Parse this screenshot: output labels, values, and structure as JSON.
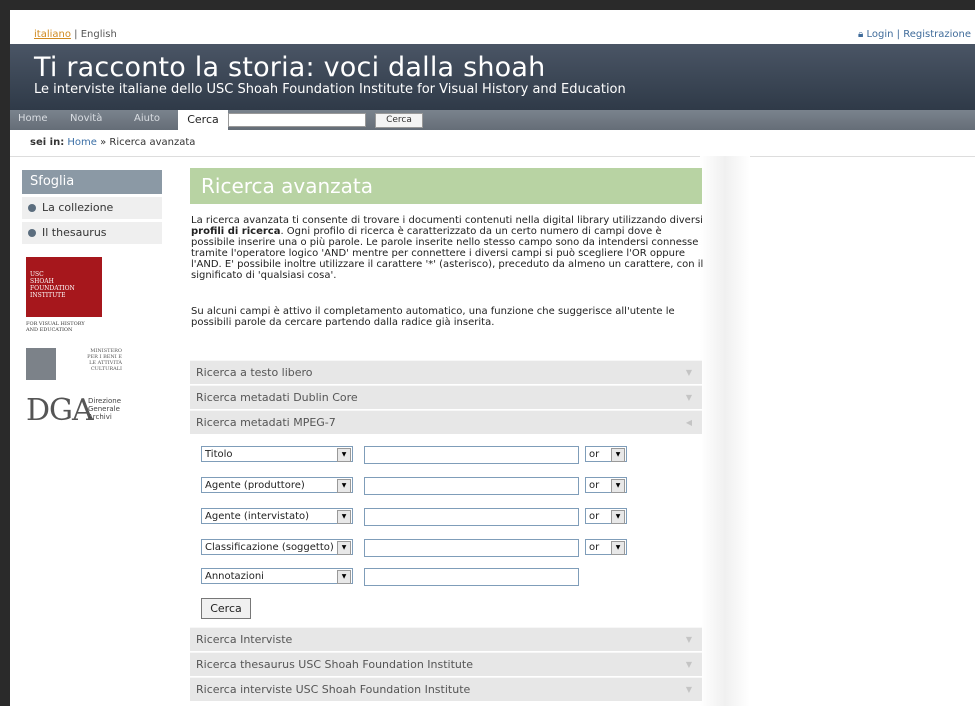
{
  "lang": {
    "italiano": "italiano",
    "sep": " | ",
    "english": "English"
  },
  "auth": {
    "login": "Login",
    "sep": " | ",
    "register": "Registrazione"
  },
  "header": {
    "title": "Ti racconto la storia: voci dalla shoah",
    "subtitle": "Le interviste italiane dello USC Shoah Foundation Institute for Visual History and Education"
  },
  "nav": {
    "home": "Home",
    "novita": "Novità",
    "aiuto": "Aiuto",
    "cerca": "Cerca",
    "search_button": "Cerca",
    "search_value": ""
  },
  "breadcrumb": {
    "prefix": "sei in:",
    "home": "Home",
    "sep": " » ",
    "current": "Ricerca avanzata"
  },
  "sidebar": {
    "heading": "Sfoglia",
    "items": [
      {
        "label": "La collezione"
      },
      {
        "label": "Il thesaurus"
      }
    ]
  },
  "logos": {
    "usc": [
      "USC",
      "SHOAH",
      "FOUNDATION",
      "INSTITUTE"
    ],
    "usc_sub": [
      "FOR VISUAL HISTORY",
      "AND EDUCATION"
    ],
    "ministero": [
      "MINISTERO",
      "PER I BENI E",
      "LE ATTIVITÀ",
      "CULTURALI"
    ],
    "dga_big": "DGA",
    "dga_small": [
      "Direzione",
      "Generale",
      "Archivi"
    ]
  },
  "main": {
    "title": "Ricerca avanzata",
    "intro_before": "La ricerca avanzata ti consente di trovare i documenti contenuti nella digital library utilizzando diversi ",
    "intro_bold": "profili di ricerca",
    "intro_after": ". Ogni profilo di ricerca è caratterizzato da un certo numero di campi dove è possibile inserire una o più parole. Le parole inserite nello stesso campo sono da intendersi connesse tramite l'operatore logico 'AND' mentre per connettere i diversi campi si può scegliere l'OR oppure l'AND. E' possibile inoltre utilizzare il carattere '*' (asterisco), preceduto da almeno un carattere, con il significato di 'qualsiasi cosa'.",
    "intro2": "Su alcuni campi è attivo il completamento automatico, una funzione che suggerisce all'utente le possibili parole da cercare partendo dalla radice già inserita."
  },
  "accordion": [
    {
      "label": "Ricerca a testo libero",
      "arrow": "▼"
    },
    {
      "label": "Ricerca metadati Dublin Core",
      "arrow": "▼"
    },
    {
      "label": "Ricerca metadati MPEG-7",
      "arrow": "◀"
    },
    {
      "label": "Ricerca Interviste",
      "arrow": "▼"
    },
    {
      "label": "Ricerca thesaurus USC Shoah Foundation Institute",
      "arrow": "▼"
    },
    {
      "label": "Ricerca interviste USC Shoah Foundation Institute",
      "arrow": "▼"
    }
  ],
  "form": {
    "rows": [
      {
        "field": "Titolo",
        "value": "",
        "op": "or"
      },
      {
        "field": "Agente (produttore)",
        "value": "",
        "op": "or"
      },
      {
        "field": "Agente (intervistato)",
        "value": "",
        "op": "or"
      },
      {
        "field": "Classificazione (soggetto)",
        "value": "",
        "op": "or"
      },
      {
        "field": "Annotazioni",
        "value": ""
      }
    ],
    "submit": "Cerca",
    "dropdown_glyph": "▼"
  },
  "colors": {
    "accent_green": "#b8d3a3",
    "header_bg": "#3a4554",
    "nav_bg": "#707882",
    "usc_red": "#a6171c"
  }
}
